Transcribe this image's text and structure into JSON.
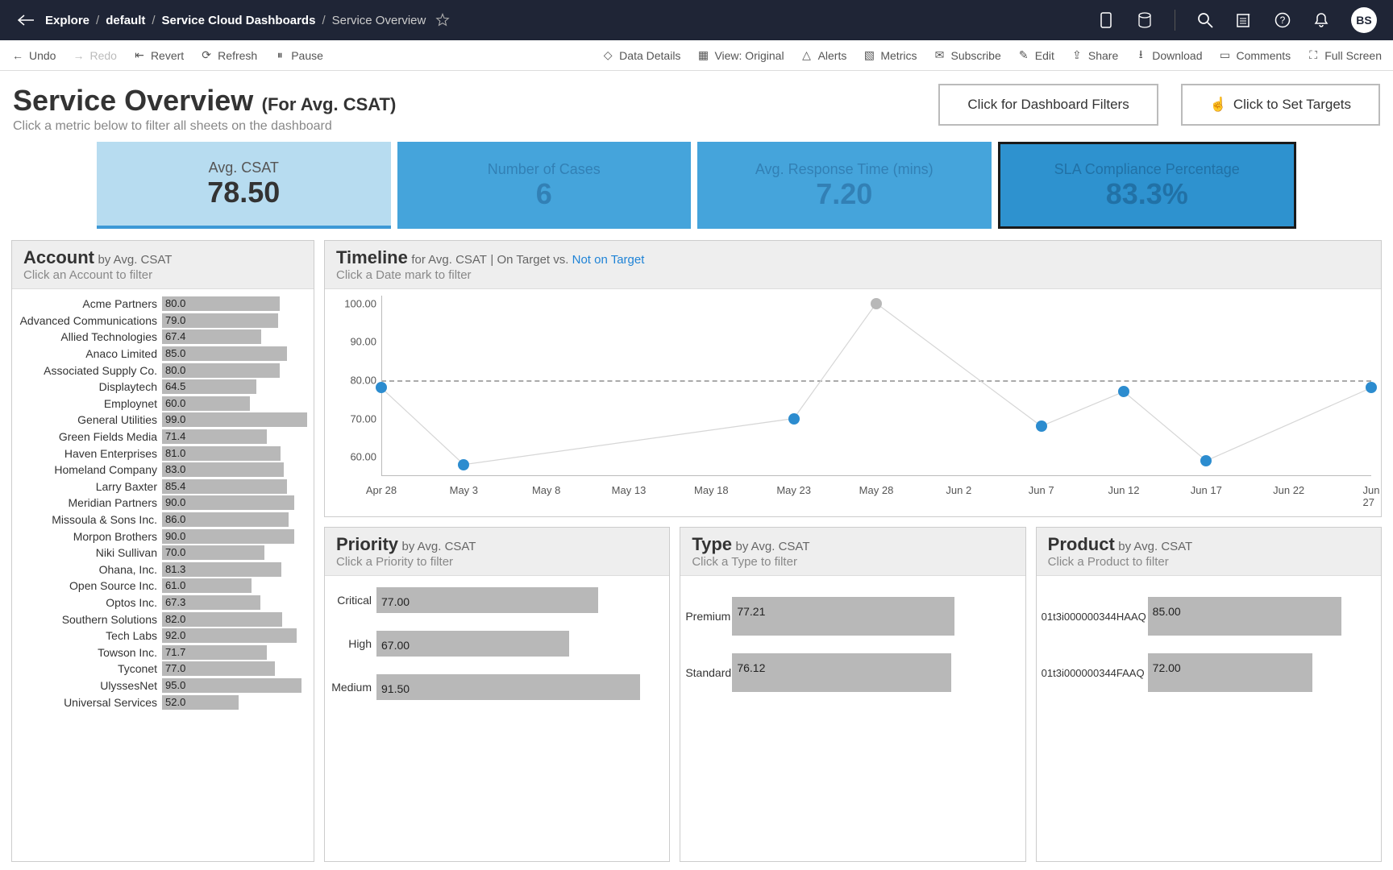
{
  "breadcrumb": {
    "root": "Explore",
    "p1": "default",
    "p2": "Service Cloud Dashboards",
    "p3": "Service Overview"
  },
  "avatar": "BS",
  "toolbar": {
    "undo": "Undo",
    "redo": "Redo",
    "revert": "Revert",
    "refresh": "Refresh",
    "pause": "Pause",
    "data_details": "Data Details",
    "view": "View: Original",
    "alerts": "Alerts",
    "metrics": "Metrics",
    "subscribe": "Subscribe",
    "edit": "Edit",
    "share": "Share",
    "download": "Download",
    "comments": "Comments",
    "full_screen": "Full Screen"
  },
  "header": {
    "title": "Service Overview",
    "subtitle": "(For Avg. CSAT)",
    "hint": "Click a metric below to filter all sheets on the dashboard",
    "btn_filters": "Click for Dashboard Filters",
    "btn_targets": "Click to Set Targets"
  },
  "tiles": [
    {
      "label": "Avg. CSAT",
      "value": "78.50"
    },
    {
      "label": "Number of Cases",
      "value": "6"
    },
    {
      "label": "Avg. Response Time (mins)",
      "value": "7.20"
    },
    {
      "label": "SLA Compliance Percentage",
      "value": "83.3%"
    }
  ],
  "account": {
    "title": "Account",
    "by": "by Avg. CSAT",
    "hint": "Click an Account to filter",
    "rows": [
      {
        "name": "Acme Partners",
        "v": 80.0
      },
      {
        "name": "Advanced Communications",
        "v": 79.0
      },
      {
        "name": "Allied Technologies",
        "v": 67.4
      },
      {
        "name": "Anaco Limited",
        "v": 85.0
      },
      {
        "name": "Associated Supply Co.",
        "v": 80.0
      },
      {
        "name": "Displaytech",
        "v": 64.5
      },
      {
        "name": "Employnet",
        "v": 60.0
      },
      {
        "name": "General Utilities",
        "v": 99.0
      },
      {
        "name": "Green Fields Media",
        "v": 71.4
      },
      {
        "name": "Haven Enterprises",
        "v": 81.0
      },
      {
        "name": "Homeland Company",
        "v": 83.0
      },
      {
        "name": "Larry Baxter",
        "v": 85.4
      },
      {
        "name": "Meridian Partners",
        "v": 90.0
      },
      {
        "name": "Missoula & Sons Inc.",
        "v": 86.0
      },
      {
        "name": "Morpon Brothers",
        "v": 90.0
      },
      {
        "name": "Niki Sullivan",
        "v": 70.0
      },
      {
        "name": "Ohana, Inc.",
        "v": 81.3
      },
      {
        "name": "Open Source Inc.",
        "v": 61.0
      },
      {
        "name": "Optos Inc.",
        "v": 67.3
      },
      {
        "name": "Southern Solutions",
        "v": 82.0
      },
      {
        "name": "Tech Labs",
        "v": 92.0
      },
      {
        "name": "Towson Inc.",
        "v": 71.7
      },
      {
        "name": "Tyconet",
        "v": 77.0
      },
      {
        "name": "UlyssesNet",
        "v": 95.0
      },
      {
        "name": "Universal Services",
        "v": 52.0
      }
    ]
  },
  "timeline": {
    "title": "Timeline",
    "by": "for Avg. CSAT",
    "hint": "Click a Date mark to filter",
    "legend_on": "On Target",
    "legend_vs": "vs.",
    "legend_not": "Not on Target",
    "y_ticks": [
      "100.00",
      "90.00",
      "80.00",
      "70.00",
      "60.00"
    ],
    "x_ticks": [
      "Apr 28",
      "May 3",
      "May 8",
      "May 13",
      "May 18",
      "May 23",
      "May 28",
      "Jun 2",
      "Jun 7",
      "Jun 12",
      "Jun 17",
      "Jun 22",
      "Jun 27"
    ]
  },
  "priority": {
    "title": "Priority",
    "by": "by Avg. CSAT",
    "hint": "Click a Priority to filter",
    "rows": [
      {
        "name": "Critical",
        "v": 77.0
      },
      {
        "name": "High",
        "v": 67.0
      },
      {
        "name": "Medium",
        "v": 91.5
      }
    ]
  },
  "type": {
    "title": "Type",
    "by": "by Avg. CSAT",
    "hint": "Click a Type to filter",
    "rows": [
      {
        "name": "Premium",
        "v": 77.21
      },
      {
        "name": "Standard",
        "v": 76.12
      }
    ]
  },
  "product": {
    "title": "Product",
    "by": "by Avg. CSAT",
    "hint": "Click a Product to filter",
    "rows": [
      {
        "name": "01t3i000000344HAAQ",
        "v": 85.0
      },
      {
        "name": "01t3i000000344FAAQ",
        "v": 72.0
      }
    ]
  },
  "chart_data": [
    {
      "type": "bar",
      "title": "Account by Avg. CSAT",
      "categories": [
        "Acme Partners",
        "Advanced Communications",
        "Allied Technologies",
        "Anaco Limited",
        "Associated Supply Co.",
        "Displaytech",
        "Employnet",
        "General Utilities",
        "Green Fields Media",
        "Haven Enterprises",
        "Homeland Company",
        "Larry Baxter",
        "Meridian Partners",
        "Missoula & Sons Inc.",
        "Morpon Brothers",
        "Niki Sullivan",
        "Ohana, Inc.",
        "Open Source Inc.",
        "Optos Inc.",
        "Southern Solutions",
        "Tech Labs",
        "Towson Inc.",
        "Tyconet",
        "UlyssesNet",
        "Universal Services"
      ],
      "values": [
        80.0,
        79.0,
        67.4,
        85.0,
        80.0,
        64.5,
        60.0,
        99.0,
        71.4,
        81.0,
        83.0,
        85.4,
        90.0,
        86.0,
        90.0,
        70.0,
        81.3,
        61.0,
        67.3,
        82.0,
        92.0,
        71.7,
        77.0,
        95.0,
        52.0
      ],
      "xlim": [
        0,
        100
      ]
    },
    {
      "type": "line",
      "title": "Timeline for Avg. CSAT",
      "x": [
        "Apr 28",
        "May 3",
        "May 23",
        "May 28",
        "Jun 7",
        "Jun 12",
        "Jun 17",
        "Jun 27"
      ],
      "values": [
        78,
        58,
        70,
        100,
        68,
        77,
        59,
        78
      ],
      "on_target": [
        false,
        false,
        false,
        true,
        false,
        false,
        false,
        false
      ],
      "reference": 80,
      "ylim": [
        55,
        102
      ],
      "xlabel": "",
      "ylabel": ""
    },
    {
      "type": "bar",
      "title": "Priority by Avg. CSAT",
      "categories": [
        "Critical",
        "High",
        "Medium"
      ],
      "values": [
        77.0,
        67.0,
        91.5
      ],
      "xlim": [
        0,
        100
      ]
    },
    {
      "type": "bar",
      "title": "Type by Avg. CSAT",
      "categories": [
        "Premium",
        "Standard"
      ],
      "values": [
        77.21,
        76.12
      ],
      "xlim": [
        0,
        100
      ]
    },
    {
      "type": "bar",
      "title": "Product by Avg. CSAT",
      "categories": [
        "01t3i000000344HAAQ",
        "01t3i000000344FAAQ"
      ],
      "values": [
        85.0,
        72.0
      ],
      "xlim": [
        0,
        100
      ]
    }
  ]
}
